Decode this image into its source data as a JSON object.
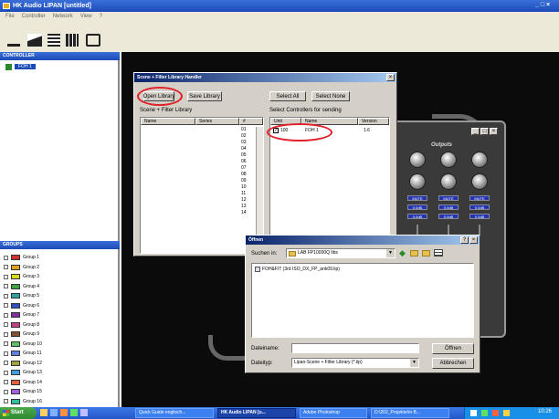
{
  "app": {
    "title": "HK Audio LIPAN [untitled]",
    "menu": [
      "File",
      "Controller",
      "Network",
      "View",
      "?"
    ],
    "window_controls": "_ □ ×"
  },
  "left_panel": {
    "controller_header": "CONTROLLER",
    "controller_item": "FOH 1",
    "groups_header": "GROUPS",
    "groups": [
      {
        "label": "Group 1",
        "color": "#d03030"
      },
      {
        "label": "Group 2",
        "color": "#e0a020"
      },
      {
        "label": "Group 3",
        "color": "#d8d820"
      },
      {
        "label": "Group 4",
        "color": "#40a040"
      },
      {
        "label": "Group 5",
        "color": "#30a0a0"
      },
      {
        "label": "Group 6",
        "color": "#3050c0"
      },
      {
        "label": "Group 7",
        "color": "#8030a0"
      },
      {
        "label": "Group 8",
        "color": "#c04080"
      },
      {
        "label": "Group 9",
        "color": "#805030"
      },
      {
        "label": "Group 10",
        "color": "#60c060"
      },
      {
        "label": "Group 11",
        "color": "#6080e0"
      },
      {
        "label": "Group 12",
        "color": "#a0a040"
      },
      {
        "label": "Group 13",
        "color": "#40a0e0"
      },
      {
        "label": "Group 14",
        "color": "#e06040"
      },
      {
        "label": "Group 15",
        "color": "#a060e0"
      },
      {
        "label": "Group 16",
        "color": "#30c0a0"
      }
    ]
  },
  "library_dialog": {
    "title": "Scene + Filter Library Handler",
    "open_library": "Open Library",
    "save_library": "Save Library",
    "select_all": "Select All",
    "select_none": "Select None",
    "library_label": "Scene + Filter Library",
    "lib_columns": [
      "Name",
      "Series",
      "#"
    ],
    "numbers": [
      "01",
      "02",
      "03",
      "04",
      "05",
      "06",
      "07",
      "08",
      "09",
      "10",
      "11",
      "12",
      "13",
      "14"
    ],
    "controllers_label": "Select Controllers for sending",
    "ctrl_columns": [
      "Unit",
      "Name",
      "Version"
    ],
    "ctrl_row": {
      "unit": "100",
      "name": "FOH 1",
      "version": "1.6"
    }
  },
  "controller_window": {
    "title": "",
    "section": "Outputs",
    "mute": "MUTE",
    "level": "0.0dB"
  },
  "open_dialog": {
    "title": "Öffnen",
    "look_in_label": "Suchen in:",
    "look_in_value": "LAB FP10000Q libs",
    "file_item": "FOH&FIT (3rd ISO_DX_FP_ank09.lip)",
    "filename_label": "Dateiname:",
    "filename_value": "",
    "filetype_label": "Dateityp:",
    "filetype_value": "Lipan-Scene + Filter Library (*.lip)",
    "open_button": "Öffnen",
    "cancel_button": "Abbrechen"
  },
  "taskbar": {
    "start": "Start",
    "tasks": [
      "Quick Guide englisch...",
      "HK Audio LIPAN [u...",
      "Adobe Photoshop",
      "D:\\202_Projekte\\in B..."
    ],
    "clock": "10:26"
  }
}
